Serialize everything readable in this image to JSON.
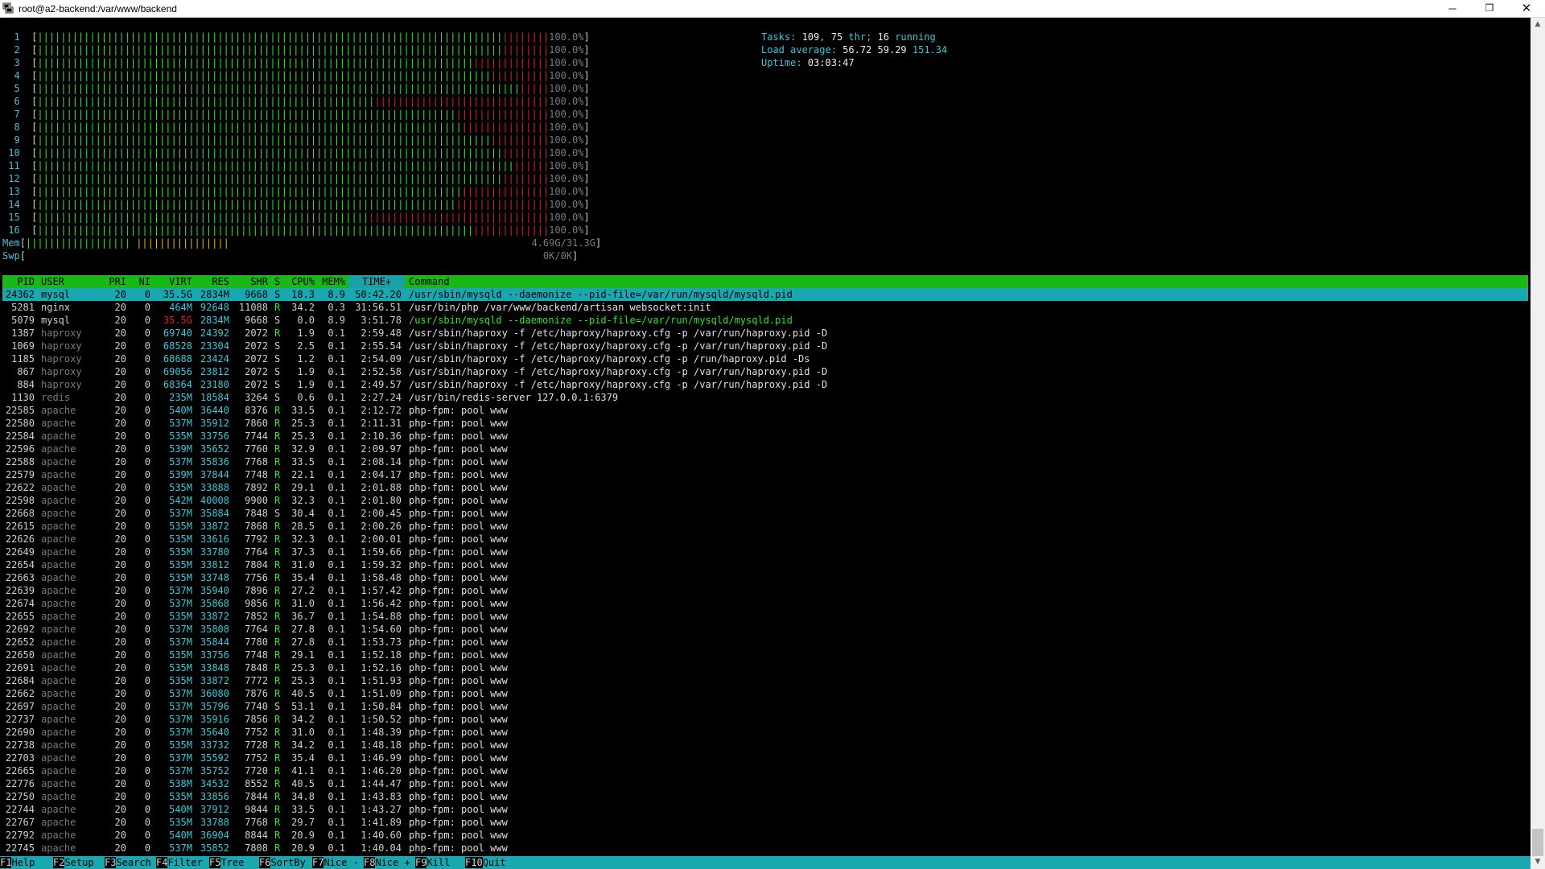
{
  "window": {
    "title": "root@a2-backend:/var/www/backend",
    "icon": "putty-terminal-icon",
    "buttons": {
      "minimize": "─",
      "restore": "❐",
      "close": "✕"
    }
  },
  "cpu_meters": [
    {
      "id": "1",
      "value": "100.0%",
      "green": 80,
      "red": 8
    },
    {
      "id": "2",
      "value": "100.0%",
      "green": 80,
      "red": 8
    },
    {
      "id": "3",
      "value": "100.0%",
      "green": 75,
      "red": 13
    },
    {
      "id": "4",
      "value": "100.0%",
      "green": 78,
      "red": 10
    },
    {
      "id": "5",
      "value": "100.0%",
      "green": 83,
      "red": 5
    },
    {
      "id": "6",
      "value": "100.0%",
      "green": 58,
      "red": 30
    },
    {
      "id": "7",
      "value": "100.0%",
      "green": 72,
      "red": 16
    },
    {
      "id": "8",
      "value": "100.0%",
      "green": 73,
      "red": 15
    },
    {
      "id": "9",
      "value": "100.0%",
      "green": 78,
      "red": 10
    },
    {
      "id": "10",
      "value": "100.0%",
      "green": 80,
      "red": 8
    },
    {
      "id": "11",
      "value": "100.0%",
      "green": 82,
      "red": 6
    },
    {
      "id": "12",
      "value": "100.0%",
      "green": 80,
      "red": 8
    },
    {
      "id": "13",
      "value": "100.0%",
      "green": 73,
      "red": 15
    },
    {
      "id": "14",
      "value": "100.0%",
      "green": 72,
      "red": 16
    },
    {
      "id": "15",
      "value": "100.0%",
      "green": 57,
      "red": 31
    },
    {
      "id": "16",
      "value": "100.0%",
      "green": 75,
      "red": 13
    }
  ],
  "mem_meter": {
    "label": "Mem",
    "value": "4.69G/31.3G",
    "used_fraction": 0.15
  },
  "swp_meter": {
    "label": "Swp",
    "value": "0K/0K",
    "used_fraction": 0
  },
  "summary": {
    "tasks_label": "Tasks: ",
    "tasks": "109",
    "thr_sep": ", ",
    "thr": "75",
    "thr_label": " thr; ",
    "running": "16",
    "running_label": " running",
    "load_label": "Load average: ",
    "load1": "56.72",
    "load5": "59.29",
    "load15": "151.34",
    "uptime_label": "Uptime: ",
    "uptime": "03:03:47"
  },
  "table": {
    "headers": {
      "pid": "PID",
      "user": "USER",
      "pri": "PRI",
      "ni": "NI",
      "virt": "VIRT",
      "res": "RES",
      "shr": "SHR",
      "s": "S",
      "cpu": "CPU%",
      "mem": "MEM%",
      "time": "TIME+",
      "cmd": "Command"
    },
    "rows": [
      {
        "pid": "24362",
        "user": "mysql",
        "pri": "20",
        "ni": "0",
        "virt": "35.5G",
        "res": "2834M",
        "shr": "9668",
        "s": "S",
        "cpu": "18.3",
        "mem": "8.9",
        "time": "50:42.20",
        "cmd": "/usr/sbin/mysqld --daemonize --pid-file=/var/run/mysqld/mysqld.pid",
        "selected": true
      },
      {
        "pid": "5281",
        "user": "nginx",
        "pri": "20",
        "ni": "0",
        "virt": "464M",
        "res": "92648",
        "shr": "11088",
        "s": "R",
        "cpu": "34.2",
        "mem": "0.3",
        "time": "31:56.51",
        "cmd": "/usr/bin/php /var/www/backend/artisan websocket:init"
      },
      {
        "pid": "5079",
        "user": "mysql",
        "pri": "20",
        "ni": "0",
        "virt": "35.5G",
        "res": "2834M",
        "shr": "9668",
        "s": "S",
        "cpu": "0.0",
        "mem": "8.9",
        "time": "3:51.78",
        "cmd": "/usr/sbin/mysqld --daemonize --pid-file=/var/run/mysqld/mysqld.pid",
        "thread": true
      },
      {
        "pid": "1387",
        "user": "haproxy",
        "pri": "20",
        "ni": "0",
        "virt": "69740",
        "res": "24392",
        "shr": "2072",
        "s": "R",
        "cpu": "1.9",
        "mem": "0.1",
        "time": "2:59.48",
        "cmd": "/usr/sbin/haproxy -f /etc/haproxy/haproxy.cfg -p /var/run/haproxy.pid -D"
      },
      {
        "pid": "1069",
        "user": "haproxy",
        "pri": "20",
        "ni": "0",
        "virt": "68528",
        "res": "23304",
        "shr": "2072",
        "s": "S",
        "cpu": "2.5",
        "mem": "0.1",
        "time": "2:55.54",
        "cmd": "/usr/sbin/haproxy -f /etc/haproxy/haproxy.cfg -p /var/run/haproxy.pid -D"
      },
      {
        "pid": "1185",
        "user": "haproxy",
        "pri": "20",
        "ni": "0",
        "virt": "68688",
        "res": "23424",
        "shr": "2072",
        "s": "S",
        "cpu": "1.2",
        "mem": "0.1",
        "time": "2:54.09",
        "cmd": "/usr/sbin/haproxy -f /etc/haproxy/haproxy.cfg -p /run/haproxy.pid -Ds"
      },
      {
        "pid": "867",
        "user": "haproxy",
        "pri": "20",
        "ni": "0",
        "virt": "69056",
        "res": "23812",
        "shr": "2072",
        "s": "S",
        "cpu": "1.9",
        "mem": "0.1",
        "time": "2:52.58",
        "cmd": "/usr/sbin/haproxy -f /etc/haproxy/haproxy.cfg -p /var/run/haproxy.pid -D"
      },
      {
        "pid": "884",
        "user": "haproxy",
        "pri": "20",
        "ni": "0",
        "virt": "68364",
        "res": "23180",
        "shr": "2072",
        "s": "S",
        "cpu": "1.9",
        "mem": "0.1",
        "time": "2:49.57",
        "cmd": "/usr/sbin/haproxy -f /etc/haproxy/haproxy.cfg -p /var/run/haproxy.pid -D"
      },
      {
        "pid": "1130",
        "user": "redis",
        "pri": "20",
        "ni": "0",
        "virt": "235M",
        "res": "18584",
        "shr": "3264",
        "s": "S",
        "cpu": "0.6",
        "mem": "0.1",
        "time": "2:27.24",
        "cmd": "/usr/bin/redis-server 127.0.0.1:6379"
      },
      {
        "pid": "22585",
        "user": "apache",
        "pri": "20",
        "ni": "0",
        "virt": "540M",
        "res": "36440",
        "shr": "8376",
        "s": "R",
        "cpu": "33.5",
        "mem": "0.1",
        "time": "2:12.72",
        "cmd": "php-fpm: pool www"
      },
      {
        "pid": "22580",
        "user": "apache",
        "pri": "20",
        "ni": "0",
        "virt": "537M",
        "res": "35912",
        "shr": "7860",
        "s": "R",
        "cpu": "25.3",
        "mem": "0.1",
        "time": "2:11.31",
        "cmd": "php-fpm: pool www"
      },
      {
        "pid": "22584",
        "user": "apache",
        "pri": "20",
        "ni": "0",
        "virt": "535M",
        "res": "33756",
        "shr": "7744",
        "s": "R",
        "cpu": "25.3",
        "mem": "0.1",
        "time": "2:10.36",
        "cmd": "php-fpm: pool www"
      },
      {
        "pid": "22596",
        "user": "apache",
        "pri": "20",
        "ni": "0",
        "virt": "539M",
        "res": "35652",
        "shr": "7760",
        "s": "R",
        "cpu": "32.9",
        "mem": "0.1",
        "time": "2:09.97",
        "cmd": "php-fpm: pool www"
      },
      {
        "pid": "22588",
        "user": "apache",
        "pri": "20",
        "ni": "0",
        "virt": "537M",
        "res": "35836",
        "shr": "7768",
        "s": "R",
        "cpu": "33.5",
        "mem": "0.1",
        "time": "2:08.14",
        "cmd": "php-fpm: pool www"
      },
      {
        "pid": "22579",
        "user": "apache",
        "pri": "20",
        "ni": "0",
        "virt": "539M",
        "res": "37844",
        "shr": "7748",
        "s": "R",
        "cpu": "22.1",
        "mem": "0.1",
        "time": "2:04.17",
        "cmd": "php-fpm: pool www"
      },
      {
        "pid": "22622",
        "user": "apache",
        "pri": "20",
        "ni": "0",
        "virt": "535M",
        "res": "33888",
        "shr": "7892",
        "s": "R",
        "cpu": "29.1",
        "mem": "0.1",
        "time": "2:01.88",
        "cmd": "php-fpm: pool www"
      },
      {
        "pid": "22598",
        "user": "apache",
        "pri": "20",
        "ni": "0",
        "virt": "542M",
        "res": "40008",
        "shr": "9900",
        "s": "R",
        "cpu": "32.3",
        "mem": "0.1",
        "time": "2:01.80",
        "cmd": "php-fpm: pool www"
      },
      {
        "pid": "22668",
        "user": "apache",
        "pri": "20",
        "ni": "0",
        "virt": "537M",
        "res": "35884",
        "shr": "7848",
        "s": "S",
        "cpu": "30.4",
        "mem": "0.1",
        "time": "2:00.45",
        "cmd": "php-fpm: pool www"
      },
      {
        "pid": "22615",
        "user": "apache",
        "pri": "20",
        "ni": "0",
        "virt": "535M",
        "res": "33872",
        "shr": "7868",
        "s": "R",
        "cpu": "28.5",
        "mem": "0.1",
        "time": "2:00.26",
        "cmd": "php-fpm: pool www"
      },
      {
        "pid": "22626",
        "user": "apache",
        "pri": "20",
        "ni": "0",
        "virt": "535M",
        "res": "33616",
        "shr": "7792",
        "s": "R",
        "cpu": "32.3",
        "mem": "0.1",
        "time": "2:00.01",
        "cmd": "php-fpm: pool www"
      },
      {
        "pid": "22649",
        "user": "apache",
        "pri": "20",
        "ni": "0",
        "virt": "535M",
        "res": "33780",
        "shr": "7764",
        "s": "R",
        "cpu": "37.3",
        "mem": "0.1",
        "time": "1:59.66",
        "cmd": "php-fpm: pool www"
      },
      {
        "pid": "22654",
        "user": "apache",
        "pri": "20",
        "ni": "0",
        "virt": "535M",
        "res": "33812",
        "shr": "7804",
        "s": "R",
        "cpu": "31.0",
        "mem": "0.1",
        "time": "1:59.32",
        "cmd": "php-fpm: pool www"
      },
      {
        "pid": "22663",
        "user": "apache",
        "pri": "20",
        "ni": "0",
        "virt": "535M",
        "res": "33748",
        "shr": "7756",
        "s": "R",
        "cpu": "35.4",
        "mem": "0.1",
        "time": "1:58.48",
        "cmd": "php-fpm: pool www"
      },
      {
        "pid": "22639",
        "user": "apache",
        "pri": "20",
        "ni": "0",
        "virt": "537M",
        "res": "35940",
        "shr": "7896",
        "s": "R",
        "cpu": "27.2",
        "mem": "0.1",
        "time": "1:57.42",
        "cmd": "php-fpm: pool www"
      },
      {
        "pid": "22674",
        "user": "apache",
        "pri": "20",
        "ni": "0",
        "virt": "537M",
        "res": "35868",
        "shr": "9856",
        "s": "R",
        "cpu": "31.0",
        "mem": "0.1",
        "time": "1:56.42",
        "cmd": "php-fpm: pool www"
      },
      {
        "pid": "22655",
        "user": "apache",
        "pri": "20",
        "ni": "0",
        "virt": "535M",
        "res": "33872",
        "shr": "7852",
        "s": "R",
        "cpu": "36.7",
        "mem": "0.1",
        "time": "1:54.88",
        "cmd": "php-fpm: pool www"
      },
      {
        "pid": "22692",
        "user": "apache",
        "pri": "20",
        "ni": "0",
        "virt": "537M",
        "res": "35808",
        "shr": "7764",
        "s": "R",
        "cpu": "27.8",
        "mem": "0.1",
        "time": "1:54.60",
        "cmd": "php-fpm: pool www"
      },
      {
        "pid": "22652",
        "user": "apache",
        "pri": "20",
        "ni": "0",
        "virt": "537M",
        "res": "35844",
        "shr": "7780",
        "s": "R",
        "cpu": "27.8",
        "mem": "0.1",
        "time": "1:53.73",
        "cmd": "php-fpm: pool www"
      },
      {
        "pid": "22650",
        "user": "apache",
        "pri": "20",
        "ni": "0",
        "virt": "535M",
        "res": "33756",
        "shr": "7748",
        "s": "R",
        "cpu": "29.1",
        "mem": "0.1",
        "time": "1:52.18",
        "cmd": "php-fpm: pool www"
      },
      {
        "pid": "22691",
        "user": "apache",
        "pri": "20",
        "ni": "0",
        "virt": "535M",
        "res": "33848",
        "shr": "7848",
        "s": "R",
        "cpu": "25.3",
        "mem": "0.1",
        "time": "1:52.16",
        "cmd": "php-fpm: pool www"
      },
      {
        "pid": "22684",
        "user": "apache",
        "pri": "20",
        "ni": "0",
        "virt": "535M",
        "res": "33872",
        "shr": "7772",
        "s": "R",
        "cpu": "25.3",
        "mem": "0.1",
        "time": "1:51.93",
        "cmd": "php-fpm: pool www"
      },
      {
        "pid": "22662",
        "user": "apache",
        "pri": "20",
        "ni": "0",
        "virt": "537M",
        "res": "36080",
        "shr": "7876",
        "s": "R",
        "cpu": "40.5",
        "mem": "0.1",
        "time": "1:51.09",
        "cmd": "php-fpm: pool www"
      },
      {
        "pid": "22697",
        "user": "apache",
        "pri": "20",
        "ni": "0",
        "virt": "537M",
        "res": "35796",
        "shr": "7740",
        "s": "S",
        "cpu": "53.1",
        "mem": "0.1",
        "time": "1:50.84",
        "cmd": "php-fpm: pool www"
      },
      {
        "pid": "22737",
        "user": "apache",
        "pri": "20",
        "ni": "0",
        "virt": "537M",
        "res": "35916",
        "shr": "7856",
        "s": "R",
        "cpu": "34.2",
        "mem": "0.1",
        "time": "1:50.52",
        "cmd": "php-fpm: pool www"
      },
      {
        "pid": "22690",
        "user": "apache",
        "pri": "20",
        "ni": "0",
        "virt": "537M",
        "res": "35640",
        "shr": "7752",
        "s": "R",
        "cpu": "31.0",
        "mem": "0.1",
        "time": "1:48.39",
        "cmd": "php-fpm: pool www"
      },
      {
        "pid": "22738",
        "user": "apache",
        "pri": "20",
        "ni": "0",
        "virt": "535M",
        "res": "33732",
        "shr": "7728",
        "s": "R",
        "cpu": "34.2",
        "mem": "0.1",
        "time": "1:48.18",
        "cmd": "php-fpm: pool www"
      },
      {
        "pid": "22703",
        "user": "apache",
        "pri": "20",
        "ni": "0",
        "virt": "537M",
        "res": "35592",
        "shr": "7752",
        "s": "R",
        "cpu": "35.4",
        "mem": "0.1",
        "time": "1:46.99",
        "cmd": "php-fpm: pool www"
      },
      {
        "pid": "22665",
        "user": "apache",
        "pri": "20",
        "ni": "0",
        "virt": "537M",
        "res": "35752",
        "shr": "7720",
        "s": "R",
        "cpu": "41.1",
        "mem": "0.1",
        "time": "1:46.20",
        "cmd": "php-fpm: pool www"
      },
      {
        "pid": "22776",
        "user": "apache",
        "pri": "20",
        "ni": "0",
        "virt": "538M",
        "res": "34532",
        "shr": "8552",
        "s": "R",
        "cpu": "40.5",
        "mem": "0.1",
        "time": "1:44.47",
        "cmd": "php-fpm: pool www"
      },
      {
        "pid": "22750",
        "user": "apache",
        "pri": "20",
        "ni": "0",
        "virt": "535M",
        "res": "33856",
        "shr": "7844",
        "s": "R",
        "cpu": "34.8",
        "mem": "0.1",
        "time": "1:43.83",
        "cmd": "php-fpm: pool www"
      },
      {
        "pid": "22744",
        "user": "apache",
        "pri": "20",
        "ni": "0",
        "virt": "540M",
        "res": "37912",
        "shr": "9844",
        "s": "R",
        "cpu": "33.5",
        "mem": "0.1",
        "time": "1:43.27",
        "cmd": "php-fpm: pool www"
      },
      {
        "pid": "22767",
        "user": "apache",
        "pri": "20",
        "ni": "0",
        "virt": "535M",
        "res": "33788",
        "shr": "7768",
        "s": "R",
        "cpu": "29.7",
        "mem": "0.1",
        "time": "1:41.89",
        "cmd": "php-fpm: pool www"
      },
      {
        "pid": "22792",
        "user": "apache",
        "pri": "20",
        "ni": "0",
        "virt": "540M",
        "res": "36904",
        "shr": "8844",
        "s": "R",
        "cpu": "20.9",
        "mem": "0.1",
        "time": "1:40.60",
        "cmd": "php-fpm: pool www"
      },
      {
        "pid": "22745",
        "user": "apache",
        "pri": "20",
        "ni": "0",
        "virt": "537M",
        "res": "35852",
        "shr": "7808",
        "s": "R",
        "cpu": "20.9",
        "mem": "0.1",
        "time": "1:40.04",
        "cmd": "php-fpm: pool www"
      }
    ]
  },
  "function_keys": [
    {
      "key": "F1",
      "label": "Help"
    },
    {
      "key": "F2",
      "label": "Setup"
    },
    {
      "key": "F3",
      "label": "Search"
    },
    {
      "key": "F4",
      "label": "Filter"
    },
    {
      "key": "F5",
      "label": "Tree"
    },
    {
      "key": "F6",
      "label": "SortBy"
    },
    {
      "key": "F7",
      "label": "Nice -"
    },
    {
      "key": "F8",
      "label": "Nice +"
    },
    {
      "key": "F9",
      "label": "Kill"
    },
    {
      "key": "F10",
      "label": "Quit"
    }
  ],
  "colors": {
    "header_bg": "#18b818",
    "selection_bg": "#1aa8b0",
    "fn_bar_bg": "#1aa8b0",
    "bar_green": "#2ee62e",
    "bar_red": "#e02020"
  }
}
